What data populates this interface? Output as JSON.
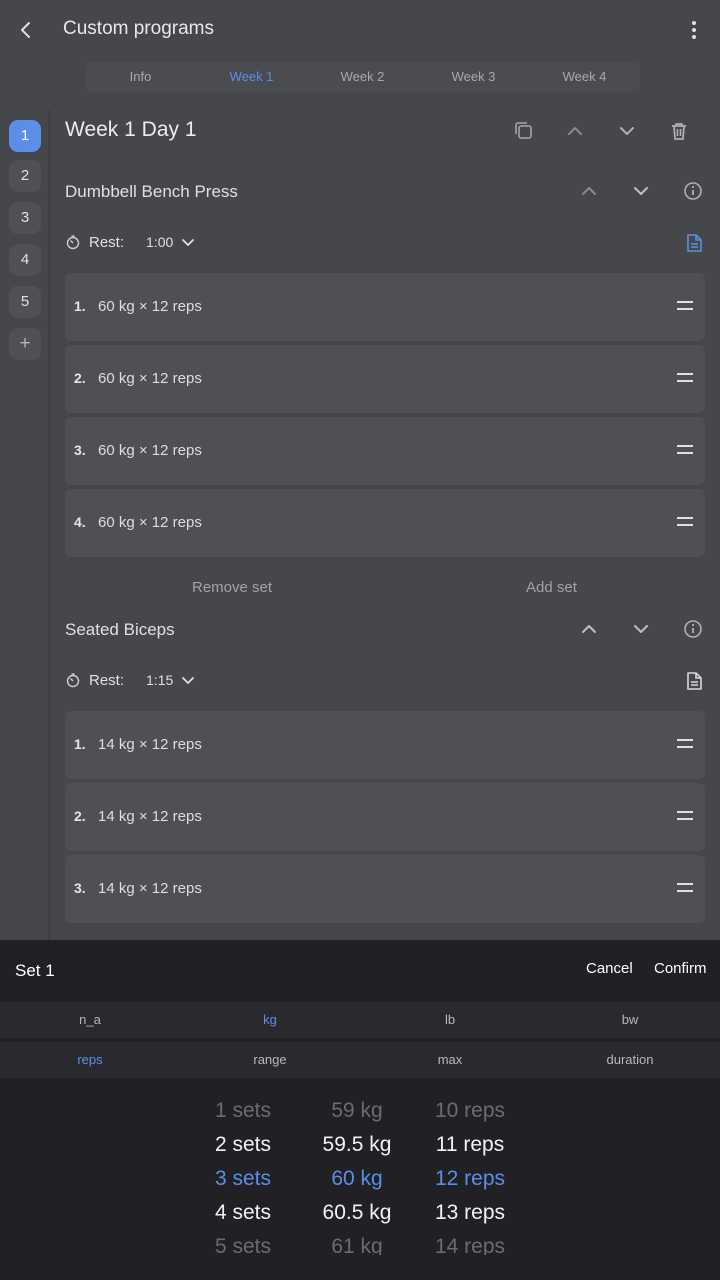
{
  "appbar": {
    "title": "Custom programs",
    "back_icon": "back-arrow-icon",
    "more_icon": "more-vertical-icon"
  },
  "tabs": [
    {
      "label": "Info",
      "active": false
    },
    {
      "label": "Week 1",
      "active": true
    },
    {
      "label": "Week 2",
      "active": false
    },
    {
      "label": "Week 3",
      "active": false
    },
    {
      "label": "Week 4",
      "active": false
    }
  ],
  "days": [
    "1",
    "2",
    "3",
    "4",
    "5"
  ],
  "add_day_label": "+",
  "day_title": "Week 1 Day 1",
  "exercises": [
    {
      "name": "Dumbbell Bench Press",
      "rest_label": "Rest:",
      "rest_value": "1:00",
      "sets": [
        {
          "num": "1.",
          "text": "60 kg × 12 reps"
        },
        {
          "num": "2.",
          "text": "60 kg × 12 reps"
        },
        {
          "num": "3.",
          "text": "60 kg × 12 reps"
        },
        {
          "num": "4.",
          "text": "60 kg × 12 reps"
        }
      ],
      "remove_set": "Remove set",
      "add_set": "Add set"
    },
    {
      "name": "Seated Biceps",
      "rest_label": "Rest:",
      "rest_value": "1:15",
      "sets": [
        {
          "num": "1.",
          "text": "14 kg × 12 reps"
        },
        {
          "num": "2.",
          "text": "14 kg × 12 reps"
        },
        {
          "num": "3.",
          "text": "14 kg × 12 reps"
        }
      ]
    }
  ],
  "sheet": {
    "title": "Set 1",
    "cancel": "Cancel",
    "confirm": "Confirm",
    "weight_units": [
      "n_a",
      "kg",
      "lb",
      "bw"
    ],
    "weight_unit_selected": "kg",
    "rep_modes": [
      "reps",
      "range",
      "max",
      "duration"
    ],
    "rep_mode_selected": "reps",
    "wheels": {
      "sets": [
        "1 sets",
        "2 sets",
        "3 sets",
        "4 sets",
        "5 sets"
      ],
      "weight": [
        "59 kg",
        "59.5 kg",
        "60 kg",
        "60.5 kg",
        "61 kg"
      ],
      "reps": [
        "10 reps",
        "11 reps",
        "12 reps",
        "13 reps",
        "14 reps"
      ]
    }
  },
  "colors": {
    "accent": "#5b8ee6",
    "background": "#46474a",
    "card": "#4f5054",
    "sheet": "#212125"
  }
}
